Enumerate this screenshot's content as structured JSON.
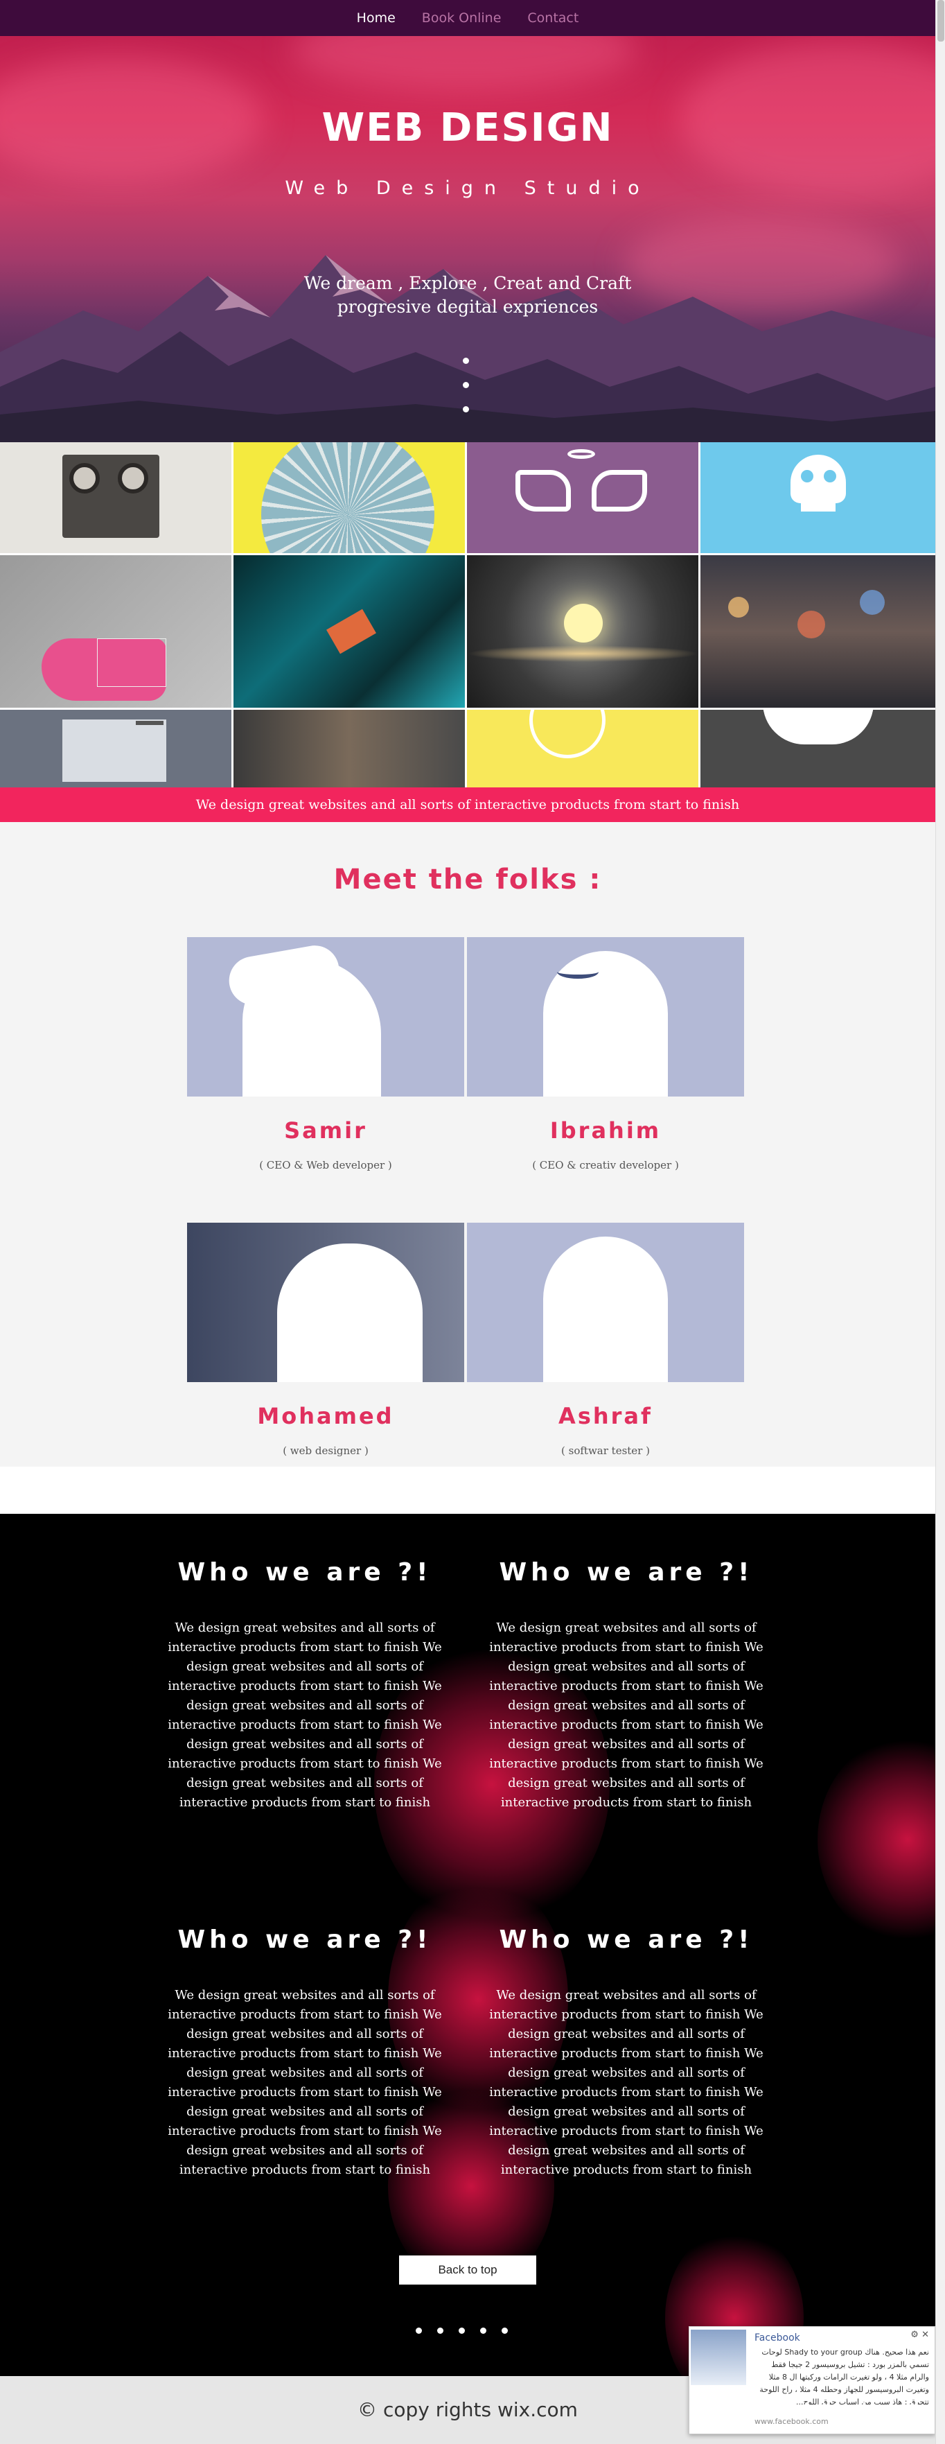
{
  "nav": {
    "items": [
      "Home",
      "Book Online",
      "Contact"
    ],
    "active": "Home"
  },
  "hero": {
    "title": "WEB DESIGN",
    "subtitle": "Web Design Studio",
    "tagline_line1": "We dream , Explore , Creat and Craft",
    "tagline_line2": "progresive degital expriences"
  },
  "banner": {
    "text": "We design great websites and all sorts of interactive products from start to finish"
  },
  "team": {
    "heading": "Meet the folks :",
    "members": [
      {
        "name": "Samir",
        "role": "( CEO & Web developer )"
      },
      {
        "name": "Ibrahim",
        "role": "( CEO & creativ developer )"
      },
      {
        "name": "Mohamed",
        "role": "( web designer )"
      },
      {
        "name": "Ashraf",
        "role": "( softwar tester )"
      }
    ]
  },
  "about": {
    "heading": "Who we are ?!",
    "body": "We design great websites and all sorts of interactive products from start to finish We design great websites and all sorts of interactive products from start to finish We design great websites and all sorts of interactive products from start to finish We design great websites and all sorts of interactive products from start to finish We design great websites and all sorts of interactive products from start to finish",
    "back_to_top": "Back to top"
  },
  "footer": {
    "text": "© copy rights wix.com"
  },
  "facebook": {
    "title": "Facebook",
    "text": "نعم هذا صحيح. هناك Shady to your group لوحات تسمي بالمزر بورد : تشيل بروسيسور 2 جيجا فقط والرام مثلا 4 ، ولو تغيرت الرامات وركبتها ال 8 مثلا وتغيرت البروسيسور للجهاز وحطله 4 مثلا ، راح اللوحة تتحرق : هاذ سبب من اسباب حرق اللوح...",
    "link": "www.facebook.com"
  },
  "colors": {
    "accent": "#f2255d",
    "nav_bg": "#3e0b3c",
    "heading_pink": "#e0305e"
  }
}
